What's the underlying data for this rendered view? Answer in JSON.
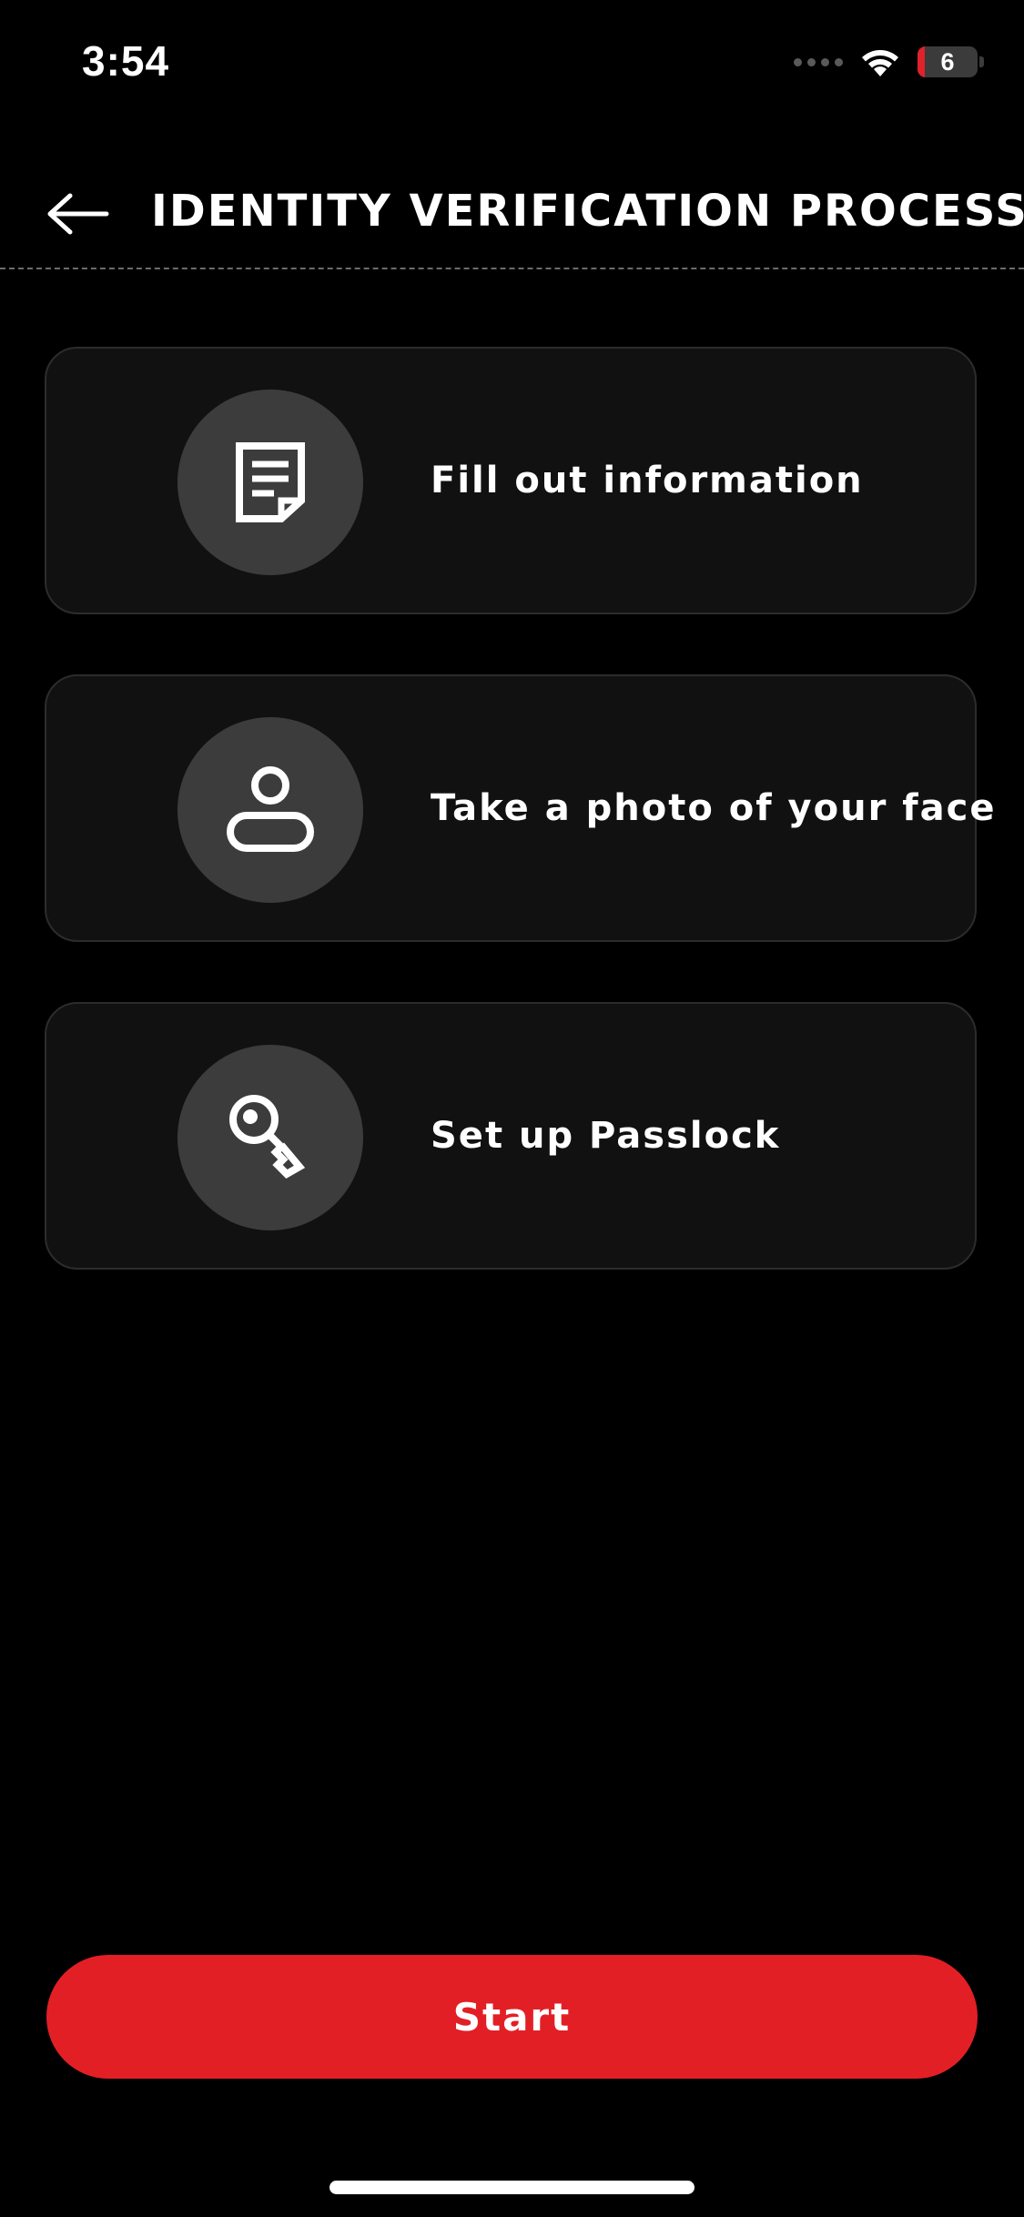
{
  "status_bar": {
    "time": "3:54",
    "battery_level": "6",
    "battery_fraction": 0.06,
    "battery_color": "#e0222a"
  },
  "header": {
    "back_icon": "arrow-left-icon",
    "title": "IDENTITY VERIFICATION PROCESS"
  },
  "steps": [
    {
      "icon": "document-icon",
      "label": "Fill out information"
    },
    {
      "icon": "person-icon",
      "label": "Take a photo of your face"
    },
    {
      "icon": "key-icon",
      "label": "Set up Passlock"
    }
  ],
  "start_button": {
    "label": "Start",
    "color": "#e31f26"
  }
}
